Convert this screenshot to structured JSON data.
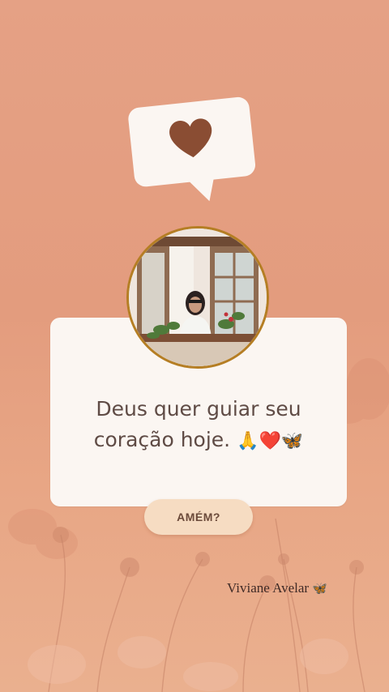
{
  "colors": {
    "background": "#e39c7e",
    "card": "#fbf6f2",
    "heart": "#8a4d33",
    "button": "#f6dcc2",
    "photo_border": "#b57e24"
  },
  "reaction": {
    "icon": "heart-icon"
  },
  "message": {
    "line1": "Deus quer guiar seu",
    "line2": "coração hoje.",
    "emojis": "🙏❤️🦋"
  },
  "button": {
    "label": "AMÉM?"
  },
  "author": {
    "name": "Viviane Avelar",
    "emoji": "🦋"
  }
}
